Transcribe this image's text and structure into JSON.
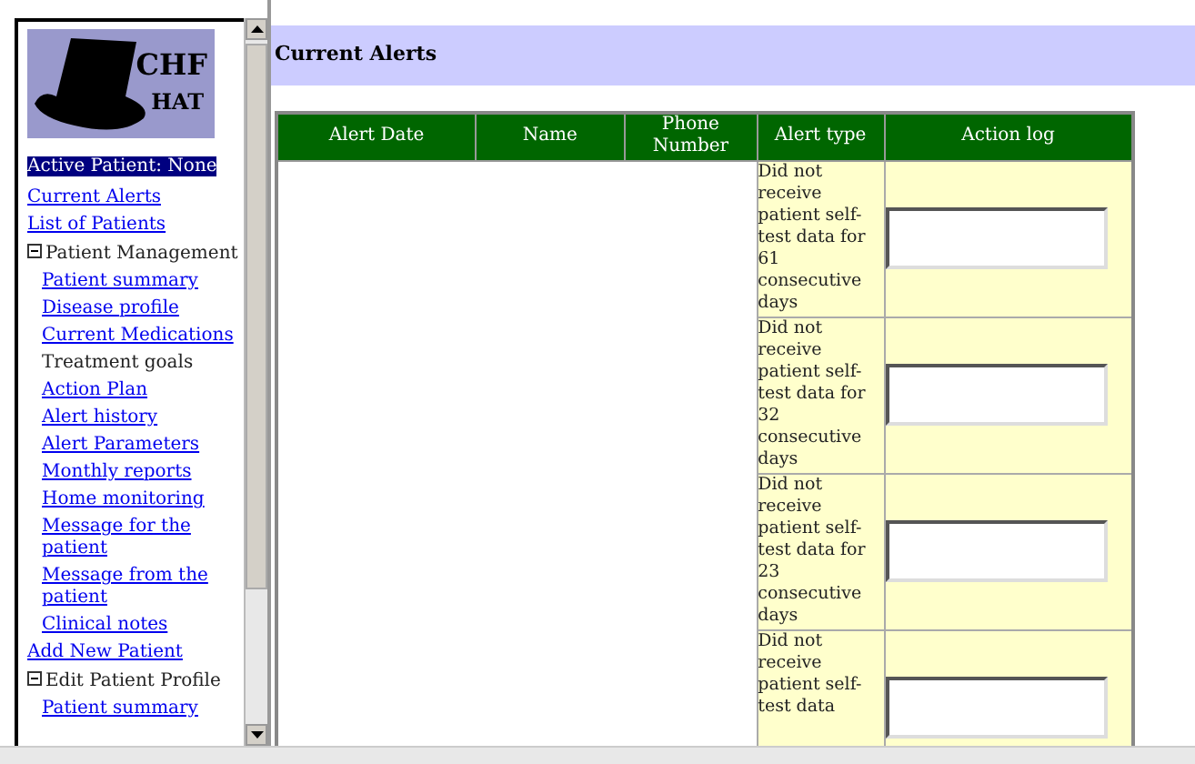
{
  "logo": {
    "line_1": "CHF",
    "line_2": "HAT"
  },
  "sidebar": {
    "items": [
      {
        "kind": "status",
        "label": "Active Patient: None",
        "selected": true
      },
      {
        "kind": "link",
        "label": "Current Alerts"
      },
      {
        "kind": "link",
        "label": "List of Patients"
      },
      {
        "kind": "section",
        "label": "Patient Management",
        "expanded": true,
        "children": [
          {
            "kind": "link",
            "label": "Patient summary"
          },
          {
            "kind": "link",
            "label": "Disease profile"
          },
          {
            "kind": "link",
            "label": "Current Medications"
          },
          {
            "kind": "text",
            "label": "Treatment goals"
          },
          {
            "kind": "link",
            "label": "Action Plan"
          },
          {
            "kind": "link",
            "label": "Alert history"
          },
          {
            "kind": "link",
            "label": "Alert Parameters"
          },
          {
            "kind": "link",
            "label": "Monthly reports"
          },
          {
            "kind": "link",
            "label": "Home monitoring"
          },
          {
            "kind": "link",
            "label": "Message for the patient"
          },
          {
            "kind": "link",
            "label": "Message from the patient"
          },
          {
            "kind": "link",
            "label": "Clinical notes"
          }
        ]
      },
      {
        "kind": "link",
        "label": "Add New Patient"
      },
      {
        "kind": "section",
        "label": "Edit Patient Profile",
        "expanded": true,
        "children": [
          {
            "kind": "link",
            "label": "Patient summary"
          }
        ]
      }
    ]
  },
  "page": {
    "title": "Current Alerts"
  },
  "table": {
    "columns": [
      "Alert Date",
      "Name",
      "Phone Number",
      "Alert type",
      "Action log"
    ],
    "rows": [
      {
        "alert_type": "Did not receive patient self-test data for 61 consecutive days"
      },
      {
        "alert_type": "Did not receive patient self-test data for 32 consecutive days"
      },
      {
        "alert_type": "Did not receive patient self-test data for 23 consecutive days"
      },
      {
        "alert_type": "Did not receive patient self-test data"
      }
    ]
  }
}
